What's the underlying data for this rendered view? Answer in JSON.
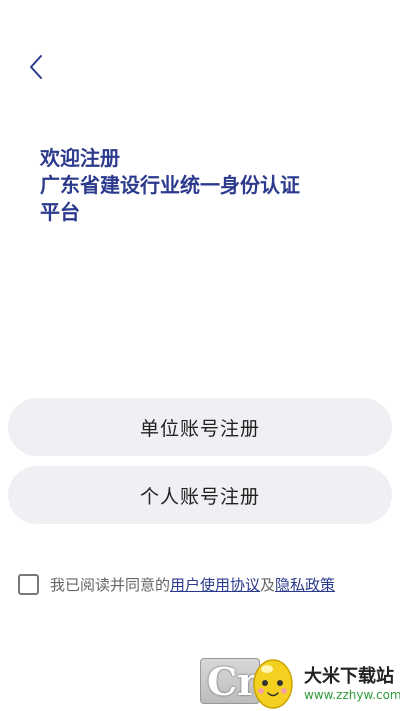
{
  "colors": {
    "accent": "#2b3a8c",
    "button_bg": "#f0f0f4",
    "link": "#2b3a8c",
    "text": "#222222",
    "muted_text": "#666666"
  },
  "header": {
    "back_icon": "chevron-left-icon"
  },
  "title": {
    "line1": "欢迎注册",
    "line2": "广东省建设行业统一身份认证",
    "line3": "平台"
  },
  "buttons": {
    "unit_register": "单位账号注册",
    "personal_register": "个人账号注册"
  },
  "agreement": {
    "checked": false,
    "prefix": "我已阅读并同意的",
    "user_agreement": "用户使用协议",
    "conjunction": "及",
    "privacy_policy": "隐私政策"
  },
  "watermark": {
    "logo_text": "Cr",
    "site_name": "大米下载站",
    "site_url": "www.zzhyw.com"
  }
}
